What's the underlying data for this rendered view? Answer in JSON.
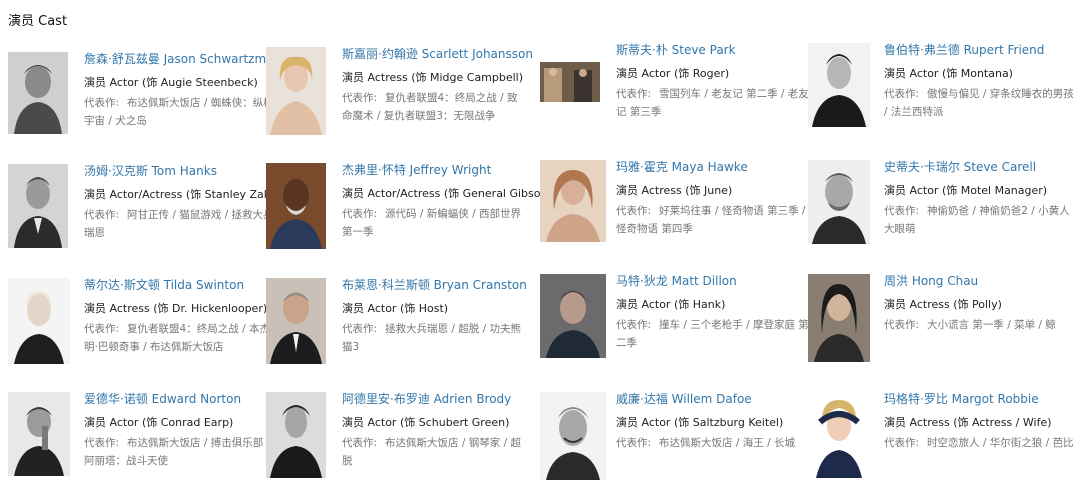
{
  "section": {
    "title": "演员 Cast"
  },
  "cast": [
    {
      "name": "詹森·舒瓦兹曼 Jason Schwartzman",
      "role": "演员 Actor (饰 Augie Steenbeck)",
      "works_label": "代表作:",
      "works": "布达佩斯大饭店 / 蜘蛛侠：纵横宇宙 / 犬之岛"
    },
    {
      "name": "斯嘉丽·约翰逊 Scarlett Johansson",
      "role": "演员 Actress (饰 Midge Campbell)",
      "works_label": "代表作:",
      "works": "复仇者联盟4：终局之战 / 致命魔术 / 复仇者联盟3：无限战争"
    },
    {
      "name": "斯蒂夫·朴 Steve Park",
      "role": "演员 Actor (饰 Roger)",
      "works_label": "代表作:",
      "works": "雪国列车 / 老友记 第二季 / 老友记 第三季"
    },
    {
      "name": "鲁伯特·弗兰德 Rupert Friend",
      "role": "演员 Actor (饰 Montana)",
      "works_label": "代表作:",
      "works": "傲慢与偏见 / 穿条纹睡衣的男孩 / 法兰西特派"
    },
    {
      "name": "汤姆·汉克斯 Tom Hanks",
      "role": "演员 Actor/Actress (饰 Stanley Zak)",
      "works_label": "代表作:",
      "works": "阿甘正传 / 猫鼠游戏 / 拯救大兵瑞恩"
    },
    {
      "name": "杰弗里·怀特 Jeffrey Wright",
      "role": "演员 Actor/Actress (饰 General Gibson)",
      "works_label": "代表作:",
      "works": "源代码 / 新蝙蝠侠 / 西部世界 第一季"
    },
    {
      "name": "玛雅·霍克 Maya Hawke",
      "role": "演员 Actress (饰 June)",
      "works_label": "代表作:",
      "works": "好莱坞往事 / 怪奇物语 第三季 / 怪奇物语 第四季"
    },
    {
      "name": "史蒂夫·卡瑞尔 Steve Carell",
      "role": "演员 Actor (饰 Motel Manager)",
      "works_label": "代表作:",
      "works": "神偷奶爸 / 神偷奶爸2 / 小黄人大眼萌"
    },
    {
      "name": "蒂尔达·斯文顿 Tilda Swinton",
      "role": "演员 Actress (饰 Dr. Hickenlooper)",
      "works_label": "代表作:",
      "works": "复仇者联盟4：终局之战 / 本杰明·巴顿奇事 / 布达佩斯大饭店"
    },
    {
      "name": "布莱恩·科兰斯顿 Bryan Cranston",
      "role": "演员 Actor (饰 Host)",
      "works_label": "代表作:",
      "works": "拯救大兵瑞恩 / 超脱 / 功夫熊猫3"
    },
    {
      "name": "马特·狄龙 Matt Dillon",
      "role": "演员 Actor (饰 Hank)",
      "works_label": "代表作:",
      "works": "撞车 / 三个老枪手 / 摩登家庭 第二季"
    },
    {
      "name": "周洪 Hong Chau",
      "role": "演员 Actress (饰 Polly)",
      "works_label": "代表作:",
      "works": "大小谎言 第一季 / 菜单 / 鲸"
    },
    {
      "name": "爱德华·诺顿 Edward Norton",
      "role": "演员 Actor (饰 Conrad Earp)",
      "works_label": "代表作:",
      "works": "布达佩斯大饭店 / 搏击俱乐部 / 阿丽塔：战斗天使"
    },
    {
      "name": "阿德里安·布罗迪 Adrien Brody",
      "role": "演员 Actor (饰 Schubert Green)",
      "works_label": "代表作:",
      "works": "布达佩斯大饭店 / 钢琴家 / 超脱"
    },
    {
      "name": "威廉·达福 Willem Dafoe",
      "role": "演员 Actor (饰 Saltzburg Keitel)",
      "works_label": "代表作:",
      "works": "布达佩斯大饭店 / 海王 / 长城"
    },
    {
      "name": "玛格特·罗比 Margot Robbie",
      "role": "演员 Actress (饰 Actress / Wife)",
      "works_label": "代表作:",
      "works": "时空恋旅人 / 华尔街之狼 / 芭比"
    }
  ]
}
